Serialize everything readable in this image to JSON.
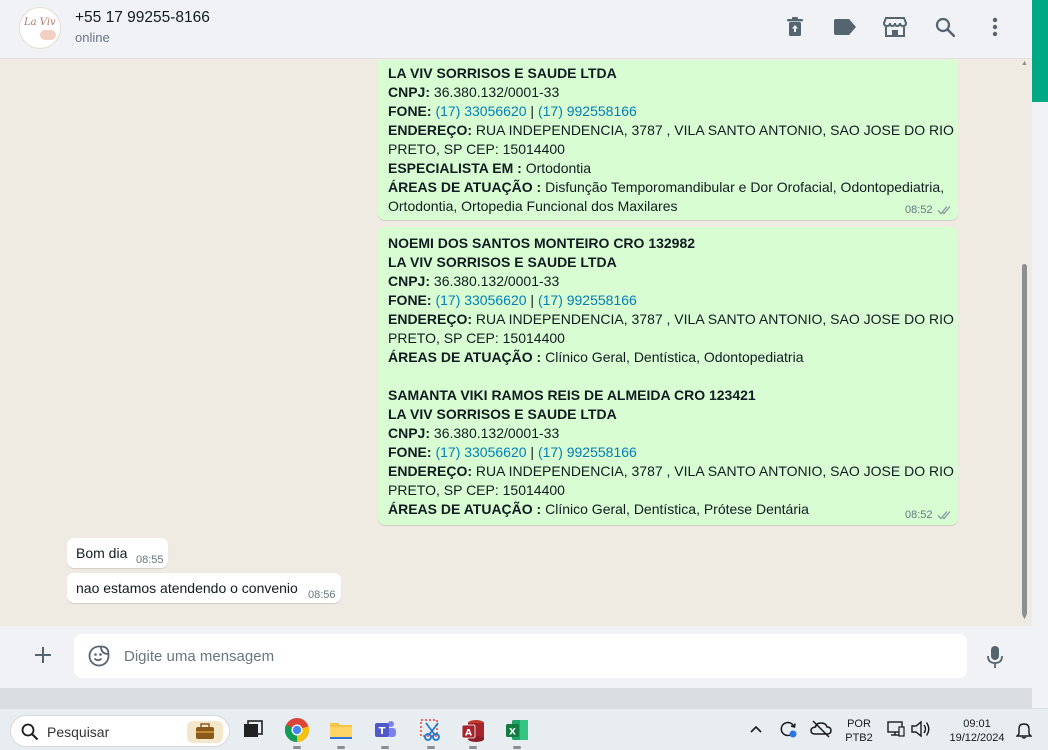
{
  "header": {
    "contact_name": "+55 17 99255-8166",
    "contact_status": "online",
    "avatar_text": "La Viv",
    "icons": [
      "trash-icon",
      "label-icon",
      "store-icon",
      "search-icon",
      "menu-dots-icon"
    ]
  },
  "messages": [
    {
      "direction": "outgoing",
      "lines": [
        {
          "label": "",
          "value": "LA VIV SORRISOS E SAUDE LTDA",
          "bold": true
        },
        {
          "label": "CNPJ:",
          "value": "36.380.132/0001-33"
        },
        {
          "label": "FONE:",
          "phone1": "(17) 33056620",
          "sep": "|",
          "phone2": "(17) 992558166"
        },
        {
          "label": "ENDEREÇO:",
          "value": "RUA INDEPENDENCIA, 3787 , VILA SANTO ANTONIO, SAO JOSE DO RIO"
        },
        {
          "label": "",
          "value": "PRETO, SP CEP: 15014400"
        },
        {
          "label": "ESPECIALISTA EM :",
          "value": "Ortodontia"
        },
        {
          "label": "ÁREAS DE ATUAÇÃO :",
          "value": "Disfunção Temporomandibular e Dor Orofacial, Odontopediatria,"
        },
        {
          "label": "",
          "value": "Ortodontia, Ortopedia Funcional dos Maxilares"
        }
      ],
      "time": "08:52",
      "ticks": "double-check-icon"
    },
    {
      "direction": "outgoing",
      "blocks": [
        {
          "name": "NOEMI DOS SANTOS MONTEIRO CRO 132982",
          "company": "LA VIV SORRISOS E SAUDE LTDA",
          "cnpj_label": "CNPJ:",
          "cnpj": "36.380.132/0001-33",
          "fone_label": "FONE:",
          "phone1": "(17) 33056620",
          "sep": "|",
          "phone2": "(17) 992558166",
          "address_label": "ENDEREÇO:",
          "address1": "RUA INDEPENDENCIA, 3787 , VILA SANTO ANTONIO, SAO JOSE DO RIO",
          "address2": "PRETO, SP CEP: 15014400",
          "areas_label": "ÁREAS DE ATUAÇÃO :",
          "areas": "Clínico Geral, Dentística, Odontopediatria"
        },
        {
          "name": "SAMANTA VIKI RAMOS REIS DE ALMEIDA CRO 123421",
          "company": "LA VIV SORRISOS E SAUDE LTDA",
          "cnpj_label": "CNPJ:",
          "cnpj": "36.380.132/0001-33",
          "fone_label": "FONE:",
          "phone1": "(17) 33056620",
          "sep": "|",
          "phone2": "(17) 992558166",
          "address_label": "ENDEREÇO:",
          "address1": "RUA INDEPENDENCIA, 3787 , VILA SANTO ANTONIO, SAO JOSE DO RIO",
          "address2": "PRETO, SP CEP: 15014400",
          "areas_label": "ÁREAS DE ATUAÇÃO :",
          "areas": "Clínico Geral, Dentística, Prótese Dentária"
        }
      ],
      "time": "08:52",
      "ticks": "double-check-icon"
    },
    {
      "direction": "incoming",
      "text": "Bom dia",
      "time": "08:55"
    },
    {
      "direction": "incoming",
      "text": "nao estamos atendendo o convenio",
      "time": "08:56"
    }
  ],
  "composer": {
    "placeholder": "Digite uma mensagem",
    "value": ""
  },
  "taskbar": {
    "search_label": "Pesquisar",
    "apps": [
      "task-view-icon",
      "chrome-icon",
      "file-explorer-icon",
      "teams-icon",
      "snipping-tool-icon",
      "access-icon",
      "excel-icon"
    ],
    "language_line1": "POR",
    "language_line2": "PTB2",
    "time": "09:01",
    "date": "19/12/2024"
  },
  "colors": {
    "outgoing_bubble": "#d9fdd3",
    "incoming_bubble": "#ffffff",
    "link": "#027eb5",
    "accent": "#00a884",
    "read_ticks": "#8696a0"
  }
}
